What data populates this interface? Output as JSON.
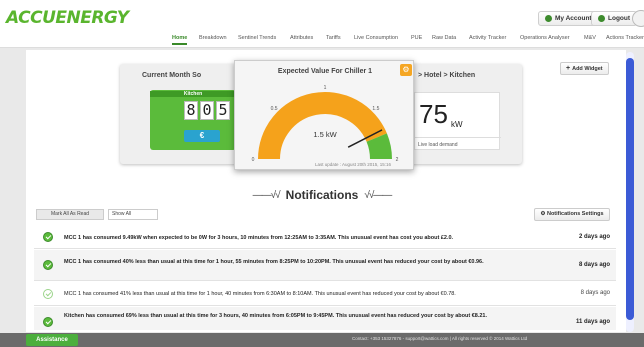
{
  "header": {
    "logo": "ACCUENERGY",
    "my_account": "My Account",
    "logout": "Logout"
  },
  "nav": {
    "tabs": [
      "Home",
      "Breakdown",
      "Sentinel Trends",
      "Attributes",
      "Tariffs",
      "Live Consumption",
      "PUE",
      "Raw Data",
      "Activity Tracker",
      "Operations Analyser",
      "M&V",
      "Actions Tracker"
    ],
    "active": "Home"
  },
  "widgets": {
    "left_title": "Current Month So",
    "kitchen_label": "Kitchen",
    "digits": [
      "8",
      "0",
      "5"
    ],
    "currency_symbol": "€",
    "right_title": "> Hotel > Kitchen",
    "live_value": "75",
    "live_unit": "kW",
    "live_label": "Live load demand",
    "add_widget": "Add Widget"
  },
  "gauge": {
    "title": "Expected Value For Chiller 1",
    "tick_labels": [
      "0",
      "0.5",
      "1",
      "1.5",
      "2"
    ],
    "value_text": "1.5 kW",
    "last_update": "Last update : August 20th 2015, 15:16",
    "value": 1.5,
    "max": 2,
    "threshold": 1.75,
    "colors": {
      "normal": "#f5a21b",
      "alert": "#5bbb3b",
      "needle": "#222222"
    }
  },
  "notifications": {
    "title": "Notifications",
    "mark_all_read": "Mark All As Read",
    "show_all": "Show All",
    "settings": "Notifications Settings",
    "items": [
      {
        "text": "MCC 1 has consumed 9.49kW when expected to be 0W for 3 hours, 10 minutes from 12:25AM to 3:35AM. This unusual event has cost you about £2.0.",
        "time": "2 days ago",
        "read": false
      },
      {
        "text": "MCC 1 has consumed 40% less than usual at this time for 1 hour, 55 minutes from 8:25PM to 10:20PM. This unusual event has reduced your cost by about €0.96.",
        "time": "8 days ago",
        "read": false
      },
      {
        "text": "MCC 1 has consumed 41% less than usual at this time for 1 hour, 40 minutes from 6:30AM to 8:10AM. This unusual event has reduced your cost by about €0.78.",
        "time": "8 days ago",
        "read": true
      },
      {
        "text": "Kitchen has consumed 69% less than usual at this time for 3 hours, 40 minutes from 6:05PM to 9:45PM. This unusual event has reduced your cost by about €8.21.",
        "time": "11 days ago",
        "read": false
      }
    ]
  },
  "footer": {
    "assistance": "Assistance",
    "contact": "Contact: +353 15327876 - support@wattics.com | All rights reserved © 2014 Wattics Ltd"
  }
}
